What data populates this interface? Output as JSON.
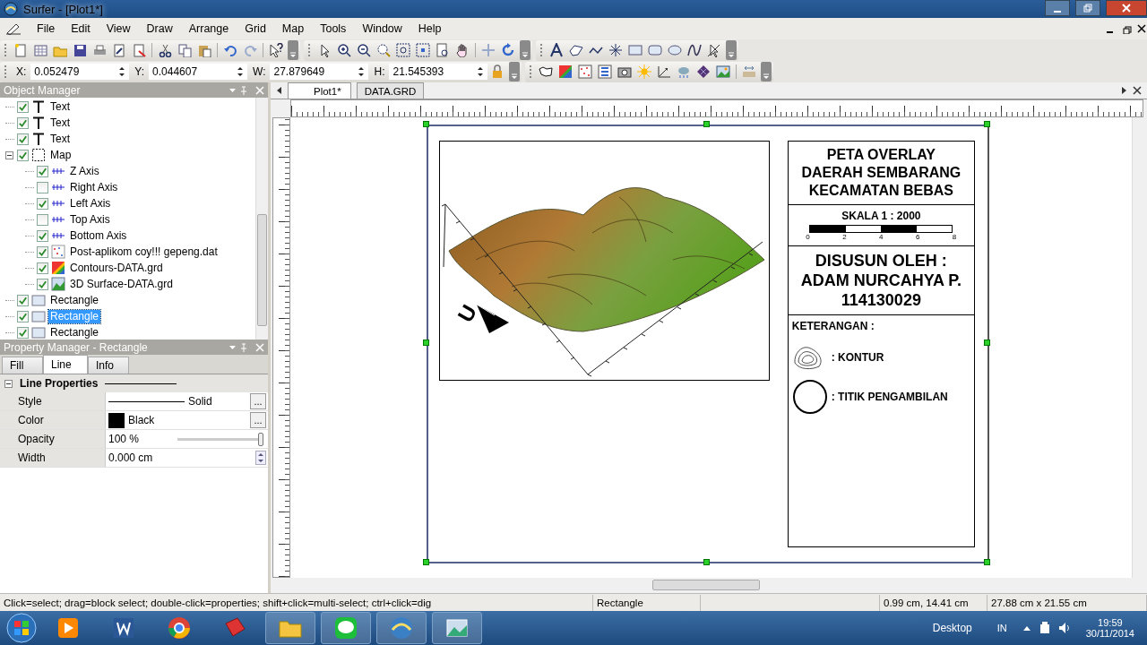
{
  "window": {
    "title": "Surfer - [Plot1*]"
  },
  "menu": [
    "File",
    "Edit",
    "View",
    "Draw",
    "Arrange",
    "Grid",
    "Map",
    "Tools",
    "Window",
    "Help"
  ],
  "coords": [
    {
      "label": "X:",
      "value": "0.052479"
    },
    {
      "label": "Y:",
      "value": "0.044607"
    },
    {
      "label": "W:",
      "value": "27.879649"
    },
    {
      "label": "H:",
      "value": "21.545393"
    }
  ],
  "object_manager": {
    "title": "Object Manager",
    "items": [
      {
        "label": "Text",
        "kind": "text",
        "checked": true,
        "selected": false
      },
      {
        "label": "Text",
        "kind": "text",
        "checked": true,
        "selected": false
      },
      {
        "label": "Text",
        "kind": "text",
        "checked": true,
        "selected": false
      },
      {
        "label": "Map",
        "kind": "map",
        "checked": true,
        "selected": false,
        "expanded": true,
        "children": [
          {
            "label": "Z Axis",
            "kind": "axis",
            "checked": true,
            "selected": false
          },
          {
            "label": "Right Axis",
            "kind": "axis",
            "checked": false,
            "selected": false
          },
          {
            "label": "Left Axis",
            "kind": "axis",
            "checked": true,
            "selected": false
          },
          {
            "label": "Top Axis",
            "kind": "axis",
            "checked": false,
            "selected": false
          },
          {
            "label": "Bottom Axis",
            "kind": "axis",
            "checked": true,
            "selected": false
          },
          {
            "label": "Post-aplikom coy!!! gepeng.dat",
            "kind": "post",
            "checked": true,
            "selected": false
          },
          {
            "label": "Contours-DATA.grd",
            "kind": "contour",
            "checked": true,
            "selected": false
          },
          {
            "label": "3D Surface-DATA.grd",
            "kind": "surface",
            "checked": true,
            "selected": false
          }
        ]
      },
      {
        "label": "Rectangle",
        "kind": "rect",
        "checked": true,
        "selected": false
      },
      {
        "label": "Rectangle",
        "kind": "rect",
        "checked": true,
        "selected": true
      },
      {
        "label": "Rectangle",
        "kind": "rect",
        "checked": true,
        "selected": false
      }
    ]
  },
  "property_manager": {
    "title": "Property Manager - Rectangle",
    "tabs": [
      {
        "label": "Fill",
        "selected": false
      },
      {
        "label": "Line",
        "selected": true
      },
      {
        "label": "Info",
        "selected": false
      }
    ],
    "section": "Line Properties",
    "rows": [
      {
        "name": "Style",
        "kind": "style",
        "value": "Solid",
        "button": "..."
      },
      {
        "name": "Color",
        "kind": "color",
        "value": "Black",
        "color": "#000000",
        "button": "..."
      },
      {
        "name": "Opacity",
        "kind": "slider",
        "value": "100 %",
        "level": 1
      },
      {
        "name": "Width",
        "kind": "spin",
        "value": "0.000 cm"
      }
    ]
  },
  "doc_tabs": [
    {
      "label": "Plot1*",
      "selected": true
    },
    {
      "label": "DATA.GRD",
      "selected": false
    }
  ],
  "plot": {
    "north_label": "U",
    "legend": {
      "title_lines": [
        "PETA OVERLAY",
        "DAERAH SEMBARANG",
        "KECAMATAN BEBAS"
      ],
      "scale_title": "SKALA 1 : 2000",
      "scale_ticks": [
        "0",
        "2",
        "4",
        "6",
        "8"
      ],
      "author_lines": [
        "DISUSUN OLEH :",
        "ADAM NURCAHYA P.",
        "114130029"
      ],
      "legend_title": "KETERANGAN :",
      "entries": [
        {
          "kind": "contour",
          "label": ":  KONTUR"
        },
        {
          "kind": "point",
          "label": ":  TITIK PENGAMBILAN"
        }
      ]
    }
  },
  "status_bar": {
    "hint": "Click=select; drag=block select; double-click=properties; shift+click=multi-select; ctrl+click=dig",
    "selection": "Rectangle",
    "position": "0.99 cm, 14.41 cm",
    "size": "27.88 cm x 21.55 cm"
  },
  "taskbar": {
    "desktop": "Desktop",
    "lang": "IN",
    "time": "19:59",
    "date": "30/11/2014"
  }
}
